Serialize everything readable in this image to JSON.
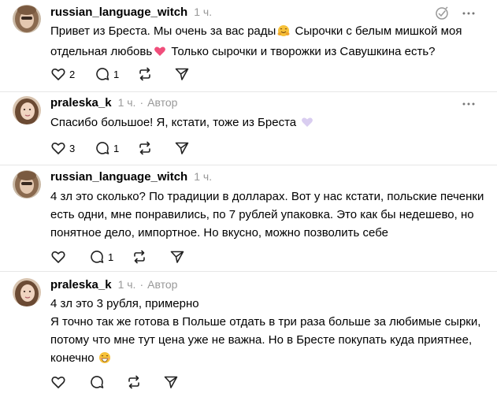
{
  "posts": [
    {
      "username": "russian_language_witch",
      "time": "1 ч.",
      "author_label": "",
      "lines": [
        "Привет из Бреста. Мы очень за вас рады",
        " Сырочки с белым мишкой моя",
        "отдельная любовь",
        " Только сырочки и творожки из Савушкина есть?"
      ],
      "likes": "2",
      "replies": "1",
      "reposts": "",
      "icons": {
        "line1": "hugging-face-emoji",
        "line2": "pink-heart-emoji"
      }
    },
    {
      "username": "praleska_k",
      "time": "1 ч.",
      "dot": "·",
      "author_label": "Автор",
      "lines": [
        "Спасибо большое! Я, кстати, тоже из Бреста"
      ],
      "likes": "3",
      "replies": "1",
      "reposts": "",
      "icons": {
        "line1": "light-purple-heart-emoji"
      }
    },
    {
      "username": "russian_language_witch",
      "time": "1 ч.",
      "author_label": "",
      "lines": [
        "4 зл это сколько? По традиции в долларах. Вот у нас кстати, польские печенки",
        "есть одни, мне понравились, по 7 рублей упаковка. Это как бы недешево, но",
        "понятное дело, импортное. Но вкусно, можно позволить себе"
      ],
      "likes": "",
      "replies": "1",
      "reposts": ""
    },
    {
      "username": "praleska_k",
      "time": "1 ч.",
      "dot": "·",
      "author_label": "Автор",
      "lines": [
        "4 зл это 3 рубля, примерно",
        "Я точно так же готова в Польше отдать в три раза больше за любимые сырки,",
        "потому что мне тут цена уже не важна. Но в Бресте покупать куда приятнее,",
        "конечно"
      ],
      "likes": "",
      "replies": "",
      "reposts": "",
      "icons": {
        "line4": "grinning-face-emoji"
      }
    }
  ],
  "colors": {
    "text": "#000000",
    "muted": "#999999",
    "divider": "#e6e6e6",
    "pink_heart": "#f04e7b",
    "purple_heart": "#d9cdf0"
  }
}
